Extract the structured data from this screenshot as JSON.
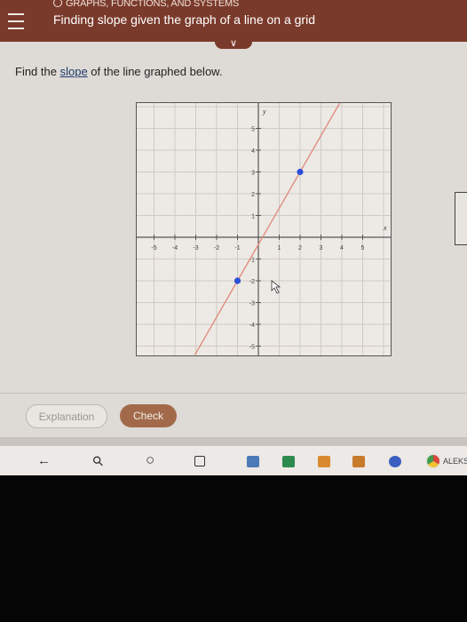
{
  "header": {
    "category": "GRAPHS, FUNCTIONS, AND SYSTEMS",
    "title": "Finding slope given the graph of a line on a grid",
    "chevron": "∨"
  },
  "prompt": {
    "before": "Find the ",
    "link": "slope",
    "after": " of the line graphed below."
  },
  "graph": {
    "x_axis_label": "x",
    "y_axis_label": "y",
    "x_ticks": [
      "-5",
      "-4",
      "-3",
      "-2",
      "-1",
      "1",
      "2",
      "3",
      "4",
      "5"
    ],
    "y_ticks": [
      "5",
      "4",
      "3",
      "2",
      "1",
      "-1",
      "-2",
      "-3",
      "-4",
      "-5"
    ],
    "line_points": [
      [
        -1,
        -2
      ],
      [
        2,
        3
      ]
    ],
    "point_color": "#2b4fd8",
    "line_color": "#e08878"
  },
  "actions": {
    "explanation_label": "Explanation",
    "check_label": "Check"
  },
  "taskbar": {
    "back_icon": "←",
    "search_icon": "⚲",
    "home_icon": "○",
    "app_label": "ALEKS"
  },
  "colors": {
    "header_bg": "#7a3a2b",
    "check_bg": "#a26a4b"
  }
}
